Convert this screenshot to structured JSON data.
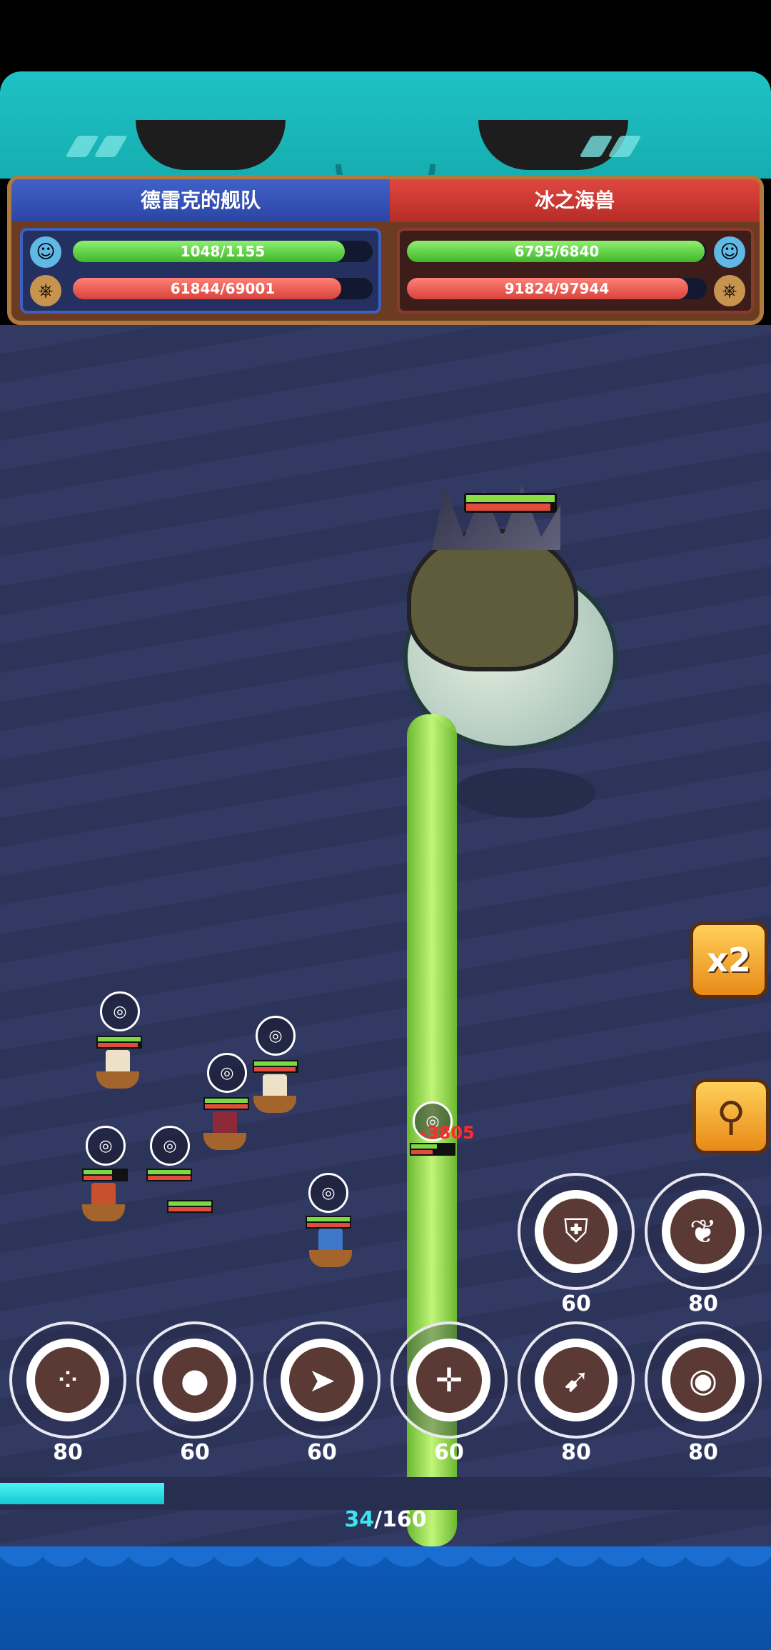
{
  "header": {
    "left_team": {
      "name": "德雷克的舰队",
      "crew_hp": {
        "current": 1048,
        "max": 1155,
        "text": "1048/1155"
      },
      "ship_hp": {
        "current": 61844,
        "max": 69001,
        "text": "61844/69001"
      }
    },
    "right_team": {
      "name": "冰之海兽",
      "crew_hp": {
        "current": 6795,
        "max": 6840,
        "text": "6795/6840"
      },
      "ship_hp": {
        "current": 91824,
        "max": 97944,
        "text": "91824/97944"
      }
    },
    "icons": [
      "crew-icon",
      "ship-wheel-icon"
    ]
  },
  "battle": {
    "damage_popup": "-3805",
    "speed_button": "x2",
    "search_button_icon": "magnifier-icon"
  },
  "skills": {
    "top_row": [
      {
        "icon": "cannon-shield-icon",
        "glyph": "⛨",
        "cost": "60"
      },
      {
        "icon": "wings-icon",
        "glyph": "❦",
        "cost": "80"
      }
    ],
    "bottom_row": [
      {
        "icon": "multi-cannonball-icon",
        "glyph": "⁘",
        "cost": "80"
      },
      {
        "icon": "cannonball-icon",
        "glyph": "●",
        "cost": "60"
      },
      {
        "icon": "shark-icon",
        "glyph": "➤",
        "cost": "60"
      },
      {
        "icon": "aim-icon",
        "glyph": "✛",
        "cost": "60"
      },
      {
        "icon": "rocket-icon",
        "glyph": "➹",
        "cost": "80"
      },
      {
        "icon": "bomb-icon",
        "glyph": "◉",
        "cost": "80"
      }
    ]
  },
  "energy": {
    "current": "34",
    "separator": "/",
    "max": "160",
    "fraction": 0.2125
  },
  "colors": {
    "left_team": "#3552b5",
    "right_team": "#d2403a",
    "hp_green": "#4fcf35",
    "hp_red": "#e24c3d",
    "energy": "#2fe1ea",
    "sea": "#323a64"
  }
}
